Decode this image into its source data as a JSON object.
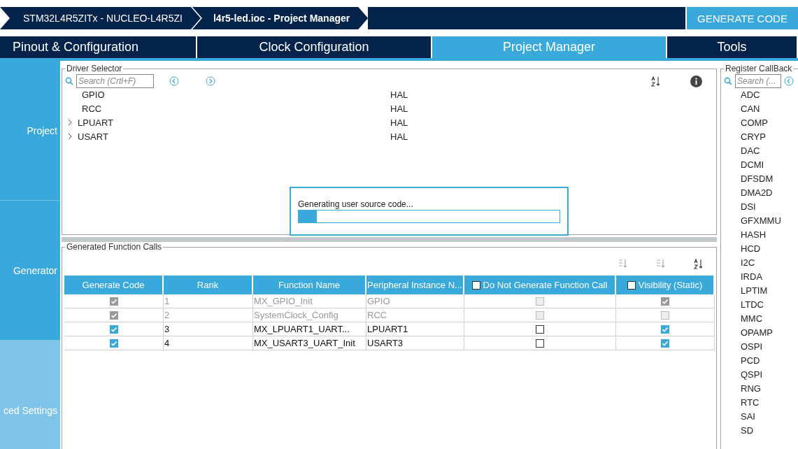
{
  "breadcrumbs": [
    {
      "label": "STM32L4R5ZITx  -  NUCLEO-L4R5ZI",
      "current": false
    },
    {
      "label": "l4r5-led.ioc - Project Manager",
      "current": true
    }
  ],
  "generate_button": "GENERATE CODE",
  "tabs": [
    {
      "label": "Pinout & Configuration",
      "selected": false
    },
    {
      "label": "Clock Configuration",
      "selected": false
    },
    {
      "label": "Project Manager",
      "selected": true
    },
    {
      "label": "Tools",
      "selected": false
    }
  ],
  "sidebar": {
    "items": [
      {
        "label": "Project",
        "selected": false
      },
      {
        "label": "Generator",
        "selected": false
      },
      {
        "label": "ced Settings",
        "selected": true
      }
    ]
  },
  "driver_selector": {
    "title": "Driver Selector",
    "search": {
      "placeholder": "Search (Crtl+F)"
    },
    "rows": [
      {
        "name": "GPIO",
        "driver": "HAL",
        "expandable": false
      },
      {
        "name": "RCC",
        "driver": "HAL",
        "expandable": false
      },
      {
        "name": "LPUART",
        "driver": "HAL",
        "expandable": true
      },
      {
        "name": "USART",
        "driver": "HAL",
        "expandable": true
      }
    ]
  },
  "progress_dialog": {
    "message": "Generating user source code...",
    "level": 0.07
  },
  "function_calls": {
    "title": "Generated Function Calls",
    "columns": [
      {
        "label": "Generate Code",
        "kind": "plain"
      },
      {
        "label": "Rank",
        "kind": "plain"
      },
      {
        "label": "Function Name",
        "kind": "plain"
      },
      {
        "label": "Peripheral Instance N...",
        "kind": "plain"
      },
      {
        "label": "Do Not Generate Function Call",
        "kind": "checkbox",
        "checked": false
      },
      {
        "label": "Visibility (Static)",
        "kind": "checkbox",
        "checked": false
      }
    ],
    "rows": [
      {
        "generate": true,
        "rank": "1",
        "function": "MX_GPIO_Init",
        "peripheral": "GPIO",
        "do_not_generate": false,
        "visibility": true,
        "disabled": true
      },
      {
        "generate": true,
        "rank": "2",
        "function": "SystemClock_Config",
        "peripheral": "RCC",
        "do_not_generate": false,
        "visibility": false,
        "disabled": true
      },
      {
        "generate": true,
        "rank": "3",
        "function": "MX_LPUART1_UART...",
        "peripheral": "LPUART1",
        "do_not_generate": false,
        "visibility": true,
        "disabled": false
      },
      {
        "generate": true,
        "rank": "4",
        "function": "MX_USART3_UART_Init",
        "peripheral": "USART3",
        "do_not_generate": false,
        "visibility": true,
        "disabled": false
      }
    ]
  },
  "callbacks": {
    "title": "Register CallBack",
    "search": {
      "placeholder": "Search (..."
    },
    "items": [
      "ADC",
      "CAN",
      "COMP",
      "CRYP",
      "DAC",
      "DCMI",
      "DFSDM",
      "DMA2D",
      "DSI",
      "GFXMMU",
      "HASH",
      "HCD",
      "I2C",
      "IRDA",
      "LPTIM",
      "LTDC",
      "MMC",
      "OPAMP",
      "OSPI",
      "PCD",
      "QSPI",
      "RNG",
      "RTC",
      "SAI",
      "SD"
    ]
  }
}
